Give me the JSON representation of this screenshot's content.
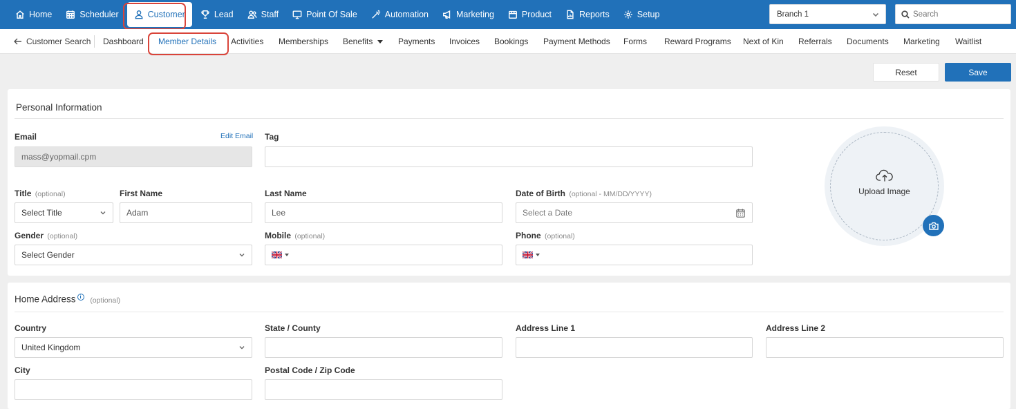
{
  "topnav": {
    "items": [
      {
        "label": "Home",
        "icon": "home-icon"
      },
      {
        "label": "Scheduler",
        "icon": "calendar-grid-icon"
      },
      {
        "label": "Customer",
        "icon": "user-icon"
      },
      {
        "label": "Lead",
        "icon": "trophy-icon"
      },
      {
        "label": "Staff",
        "icon": "users-icon"
      },
      {
        "label": "Point Of Sale",
        "icon": "monitor-icon"
      },
      {
        "label": "Automation",
        "icon": "magic-wand-icon"
      },
      {
        "label": "Marketing",
        "icon": "megaphone-icon"
      },
      {
        "label": "Product",
        "icon": "box-icon"
      },
      {
        "label": "Reports",
        "icon": "report-icon"
      },
      {
        "label": "Setup",
        "icon": "gear-icon"
      }
    ],
    "active": "Customer",
    "branch": "Branch 1",
    "search_placeholder": "Search",
    "accent": "#2171b9"
  },
  "subnav": {
    "back_label": "Customer Search",
    "items": [
      {
        "label": "Dashboard"
      },
      {
        "label": "Member Details"
      },
      {
        "label": "Activities"
      },
      {
        "label": "Memberships"
      },
      {
        "label": "Benefits"
      },
      {
        "label": "Payments"
      },
      {
        "label": "Invoices"
      },
      {
        "label": "Bookings"
      },
      {
        "label": "Payment Methods"
      },
      {
        "label": "Forms"
      },
      {
        "label": "Reward Programs"
      },
      {
        "label": "Next of Kin"
      },
      {
        "label": "Referrals"
      },
      {
        "label": "Documents"
      },
      {
        "label": "Marketing"
      },
      {
        "label": "Waitlist"
      }
    ],
    "active": "Member Details"
  },
  "actions": {
    "reset": "Reset",
    "save": "Save"
  },
  "personal": {
    "title": "Personal Information",
    "email": {
      "label": "Email",
      "edit_link": "Edit Email",
      "value": "mass@yopmail.cpm"
    },
    "tag": {
      "label": "Tag",
      "value": ""
    },
    "title_field": {
      "label": "Title",
      "optional": "(optional)",
      "value": "Select Title"
    },
    "first_name": {
      "label": "First Name",
      "value": "Adam"
    },
    "last_name": {
      "label": "Last Name",
      "value": "Lee"
    },
    "dob": {
      "label": "Date of Birth",
      "optional": "(optional - MM/DD/YYYY)",
      "placeholder": "Select a Date"
    },
    "gender": {
      "label": "Gender",
      "optional": "(optional)",
      "value": "Select Gender"
    },
    "mobile": {
      "label": "Mobile",
      "optional": "(optional)",
      "value": ""
    },
    "phone": {
      "label": "Phone",
      "optional": "(optional)",
      "value": ""
    },
    "upload_label": "Upload Image"
  },
  "address": {
    "title": "Home Address",
    "optional": "(optional)",
    "info_glyph": "i",
    "country": {
      "label": "Country",
      "value": "United Kingdom"
    },
    "state": {
      "label": "State / County",
      "value": ""
    },
    "line1": {
      "label": "Address Line 1",
      "value": ""
    },
    "line2": {
      "label": "Address Line 2",
      "value": ""
    },
    "city": {
      "label": "City",
      "value": ""
    },
    "postal": {
      "label": "Postal Code / Zip Code",
      "value": ""
    }
  }
}
